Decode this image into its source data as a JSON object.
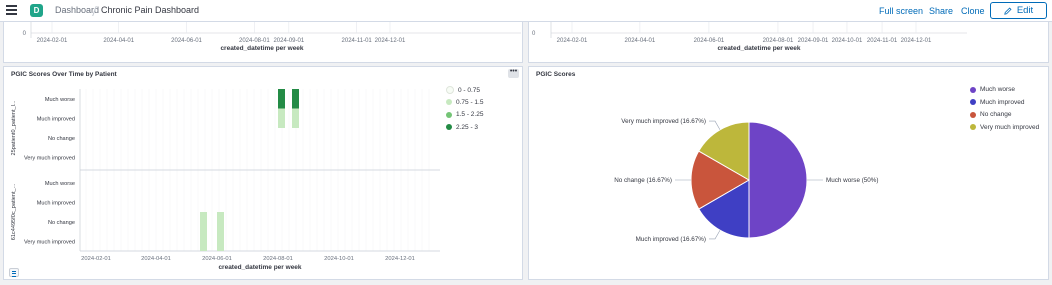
{
  "header": {
    "logo_letter": "D",
    "breadcrumb_root": "Dashboard",
    "title": "Chronic Pain Dashboard",
    "full_screen": "Full screen",
    "share": "Share",
    "clone": "Clone",
    "edit": "Edit"
  },
  "top_left_panel": {
    "y_tick": "0",
    "x_ticks": [
      "2024-02-01",
      "2024-04-01",
      "2024-06-01",
      "2024-08-01",
      "2024-09-01",
      "2024-11-01",
      "2024-12-01"
    ],
    "x_label": "created_datetime per week"
  },
  "top_right_panel": {
    "y_tick": "0",
    "x_ticks": [
      "2024-02-01",
      "2024-04-01",
      "2024-06-01",
      "2024-08-01",
      "2024-09-01",
      "2024-10-01",
      "2024-11-01",
      "2024-12-01"
    ],
    "x_label": "created_datetime per week"
  },
  "heatmap_panel": {
    "title": "PGIC Scores Over Time by Patient",
    "menu_glyph": "•••",
    "legend": [
      {
        "label": "0 - 0.75",
        "color": "#f7fcf5"
      },
      {
        "label": "0.75 - 1.5",
        "color": "#c7e9c0"
      },
      {
        "label": "1.5 - 2.25",
        "color": "#74c476"
      },
      {
        "label": "2.25 - 3",
        "color": "#238b45"
      }
    ]
  },
  "pie_panel": {
    "title": "PGIC Scores",
    "legend": [
      {
        "label": "Much worse",
        "color": "#6e44c6"
      },
      {
        "label": "Much improved",
        "color": "#3f3fc4"
      },
      {
        "label": "No change",
        "color": "#c9553c"
      },
      {
        "label": "Very much improved",
        "color": "#bdb73b"
      }
    ],
    "slice_labels": [
      "Much worse (50%)",
      "Much improved (16.67%)",
      "No change (16.67%)",
      "Very much improved (16.67%)"
    ]
  },
  "chart_data": [
    {
      "type": "heatmap",
      "title": "PGIC Scores Over Time by Patient",
      "xlabel": "created_datetime per week",
      "x_ticks": [
        "2024-02-01",
        "2024-04-01",
        "2024-06-01",
        "2024-08-01",
        "2024-10-01",
        "2024-12-01"
      ],
      "row_groups": [
        {
          "name": "25patient0_patient_l...",
          "categories": [
            "Much worse",
            "Much improved",
            "No change",
            "Very much improved"
          ],
          "cells": [
            {
              "week": "2024-08-01",
              "category": "Much worse",
              "value": 3
            },
            {
              "week": "2024-08-01",
              "category": "Much improved",
              "value": 1
            },
            {
              "week": "2024-08-15",
              "category": "Much worse",
              "value": 3
            },
            {
              "week": "2024-08-15",
              "category": "Much improved",
              "value": 1
            }
          ]
        },
        {
          "name": "61c4495f0c_patient_...",
          "categories": [
            "Much worse",
            "Much improved",
            "No change",
            "Very much improved"
          ],
          "cells": [
            {
              "week": "2024-05-15",
              "category": "No change",
              "value": 1
            },
            {
              "week": "2024-05-15",
              "category": "Very much improved",
              "value": 1
            },
            {
              "week": "2024-06-01",
              "category": "No change",
              "value": 1
            },
            {
              "week": "2024-06-01",
              "category": "Very much improved",
              "value": 1
            }
          ]
        }
      ],
      "legend": [
        "0 - 0.75",
        "0.75 - 1.5",
        "1.5 - 2.25",
        "2.25 - 3"
      ],
      "legend_position": "top-right"
    },
    {
      "type": "pie",
      "title": "PGIC Scores",
      "slices": [
        {
          "label": "Much worse",
          "percent": 50,
          "color": "#6e44c6"
        },
        {
          "label": "Much improved",
          "percent": 16.67,
          "color": "#3f3fc4"
        },
        {
          "label": "No change",
          "percent": 16.67,
          "color": "#c9553c"
        },
        {
          "label": "Very much improved",
          "percent": 16.67,
          "color": "#bdb73b"
        }
      ],
      "legend_position": "top-right"
    }
  ]
}
